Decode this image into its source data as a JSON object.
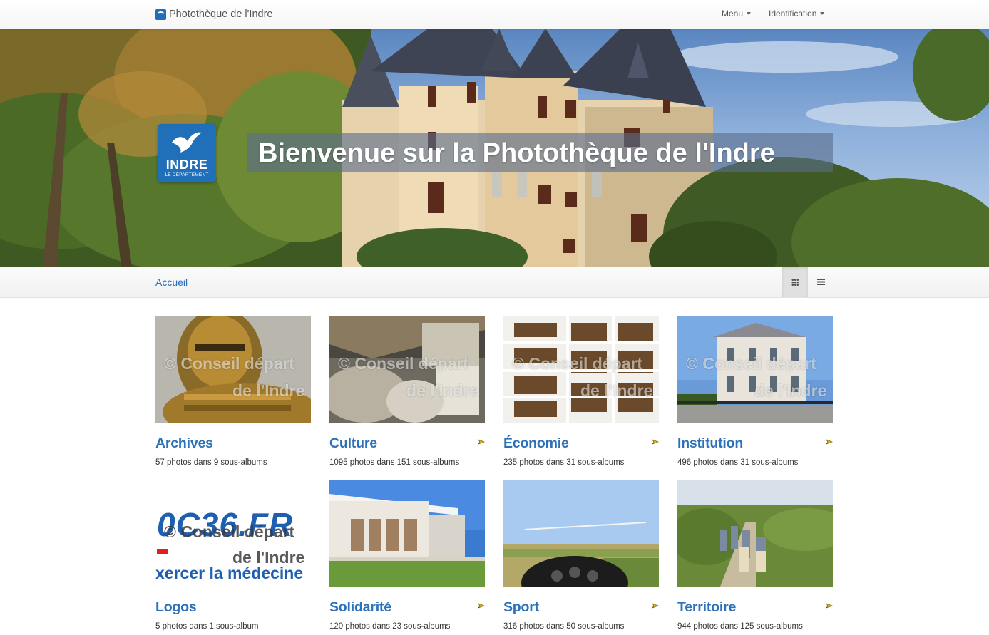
{
  "navbar": {
    "brand": "Photothèque de l'Indre",
    "menu_label": "Menu",
    "identification_label": "Identification"
  },
  "hero": {
    "title": "Bienvenue sur la Photothèque de l'Indre",
    "logo_word": "INDRE",
    "logo_sub": "LE DÉPARTEMENT"
  },
  "breadcrumb": {
    "home": "Accueil"
  },
  "view_toggle": {
    "grid": "grid-view-icon",
    "list": "list-view-icon",
    "active": "grid"
  },
  "watermark": {
    "line1": "© Conseil départ",
    "line2": "de l'Indre"
  },
  "albums": [
    {
      "title": "Archives",
      "meta": "57 photos dans 9 sous-albums"
    },
    {
      "title": "Culture",
      "meta": "1095 photos dans 151 sous-albums"
    },
    {
      "title": "Économie",
      "meta": "235 photos dans 31 sous-albums"
    },
    {
      "title": "Institution",
      "meta": "496 photos dans 31 sous-albums"
    },
    {
      "title": "Logos",
      "meta": "5 photos dans 1 sous-album",
      "thumb_text1": "0C36.FR",
      "thumb_text2": "xercer la médecine"
    },
    {
      "title": "Solidarité",
      "meta": "120 photos dans 23 sous-albums"
    },
    {
      "title": "Sport",
      "meta": "316 photos dans 50 sous-albums"
    },
    {
      "title": "Territoire",
      "meta": "944 photos dans 125 sous-albums"
    }
  ],
  "colors": {
    "link": "#2d72b8",
    "brand_blue": "#1f6fb9",
    "marker": "#e8c020"
  }
}
